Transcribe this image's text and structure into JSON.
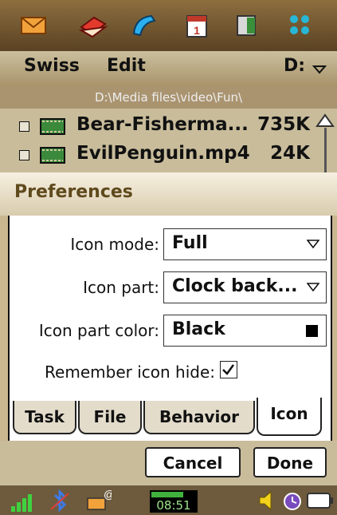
{
  "topbar": {
    "icons": [
      "mail-icon",
      "books-icon",
      "phone-icon",
      "calendar-icon",
      "contacts-icon",
      "apps-grid-icon"
    ]
  },
  "menubar": {
    "menu1": "Swiss",
    "menu2": "Edit",
    "drive": "D:"
  },
  "path": "D:\\Media files\\video\\Fun\\",
  "files": [
    {
      "name": "Bear-Fisherma...",
      "size": "735K"
    },
    {
      "name": "EvilPenguin.mp4",
      "size": "24K"
    }
  ],
  "dialog": {
    "title": "Preferences",
    "rows": {
      "icon_mode": {
        "label": "Icon mode:",
        "value": "Full"
      },
      "icon_part": {
        "label": "Icon part:",
        "value": "Clock back..."
      },
      "icon_part_color": {
        "label": "Icon part color:",
        "value": "Black",
        "swatch": "#000000"
      },
      "remember": {
        "label": "Remember icon hide:",
        "checked": true
      }
    },
    "tabs": [
      "Task",
      "File",
      "Behavior",
      "Icon"
    ],
    "active_tab": "Icon",
    "buttons": {
      "cancel": "Cancel",
      "done": "Done"
    }
  },
  "status": {
    "clock": "08:51"
  },
  "colors": {
    "header_brown": "#7a5d30",
    "title_brown": "#5f4a1d",
    "panel": "#c8bc9b"
  }
}
